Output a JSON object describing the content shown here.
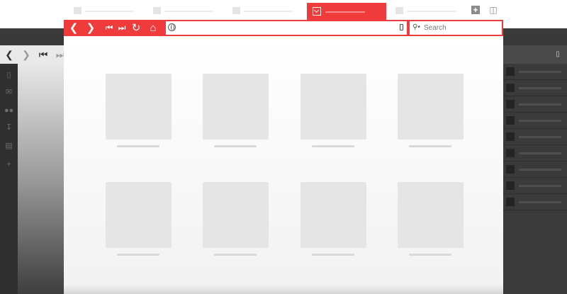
{
  "colors": {
    "accent": "#ef3b3b",
    "tab_active": "#ef3b3b",
    "toolbar": "#ef3b3b",
    "tile": "#e5e5e5",
    "background_window": "#2b2b2b"
  },
  "background_browser": {
    "nav_icons": [
      "back-icon",
      "forward-icon",
      "rewind-icon",
      "fast-forward-icon"
    ],
    "sidebar_icons": [
      "bookmarks-icon",
      "mail-icon",
      "contacts-icon",
      "downloads-icon",
      "notes-icon",
      "add-panel-icon"
    ]
  },
  "tabs": [
    {
      "icon": "blank-favicon",
      "active": false
    },
    {
      "icon": "blank-favicon",
      "active": false
    },
    {
      "icon": "blank-favicon",
      "active": false
    },
    {
      "icon": "vivaldi-favicon",
      "active": true
    },
    {
      "icon": "blank-favicon",
      "active": false
    }
  ],
  "tabstrip_buttons": [
    "new-tab-icon",
    "trash-icon"
  ],
  "toolbar": {
    "buttons": [
      "back-icon",
      "forward-icon",
      "rewind-icon",
      "fast-forward-icon",
      "reload-icon",
      "home-icon"
    ],
    "address": {
      "value": "",
      "icon": "globe-icon",
      "bookmark_icon": "bookmark-icon"
    },
    "search": {
      "placeholder": "Search",
      "icon": "search-engine-icon"
    }
  },
  "speed_dial": {
    "rows": 2,
    "columns": 4,
    "tile_count": 8
  }
}
